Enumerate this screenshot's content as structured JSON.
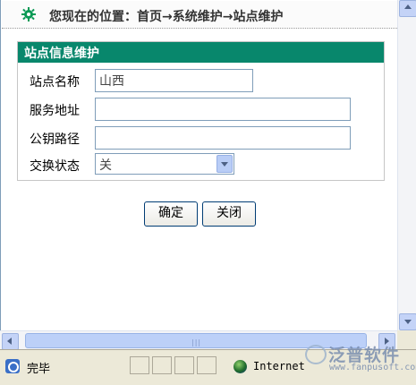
{
  "breadcrumb": {
    "text": "您现在的位置：首页→系统维护→站点维护"
  },
  "panel": {
    "title": "站点信息维护"
  },
  "form": {
    "site_name": {
      "label": "站点名称",
      "value": "山西"
    },
    "service_address": {
      "label": "服务地址",
      "value": ""
    },
    "public_key_path": {
      "label": "公钥路径",
      "value": ""
    },
    "exchange_status": {
      "label": "交换状态",
      "value": "关"
    }
  },
  "buttons": {
    "ok": "确定",
    "close": "关闭"
  },
  "statusbar": {
    "status": "完毕",
    "zone": "Internet"
  },
  "watermark": {
    "name": "泛普软件",
    "url": "www.fanpusoft.com"
  },
  "colors": {
    "header": "#08876c"
  }
}
